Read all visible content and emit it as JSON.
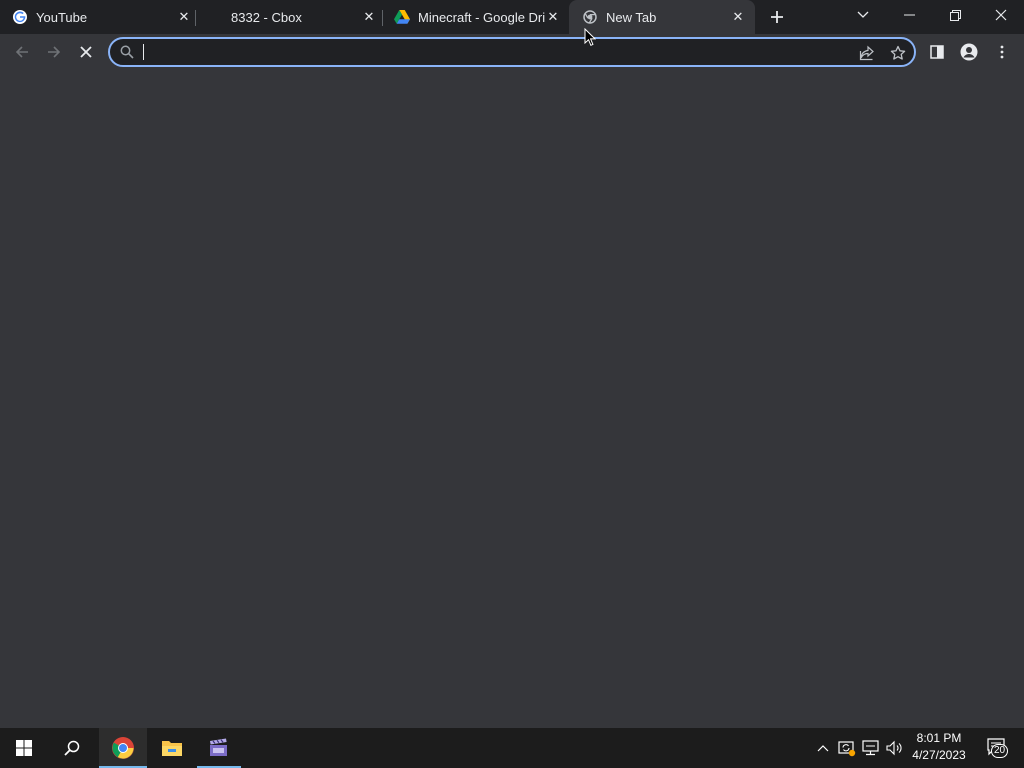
{
  "tabs": [
    {
      "title": "YouTube",
      "favicon": "google-g-icon",
      "active": false
    },
    {
      "title": "8332 - Cbox",
      "favicon": "none",
      "active": false
    },
    {
      "title": "Minecraft - Google Dri",
      "favicon": "google-drive-icon",
      "active": false
    },
    {
      "title": "New Tab",
      "favicon": "chrome-icon",
      "active": true
    }
  ],
  "omnibox": {
    "value": "",
    "placeholder": ""
  },
  "taskbar": {
    "clock_time": "8:01 PM",
    "clock_date": "4/27/2023",
    "notification_count": "20"
  },
  "colors": {
    "tabstrip": "#202124",
    "toolbar": "#35363a",
    "omnibox_focus": "#8ab4f8",
    "taskbar": "#1c1c1c"
  }
}
